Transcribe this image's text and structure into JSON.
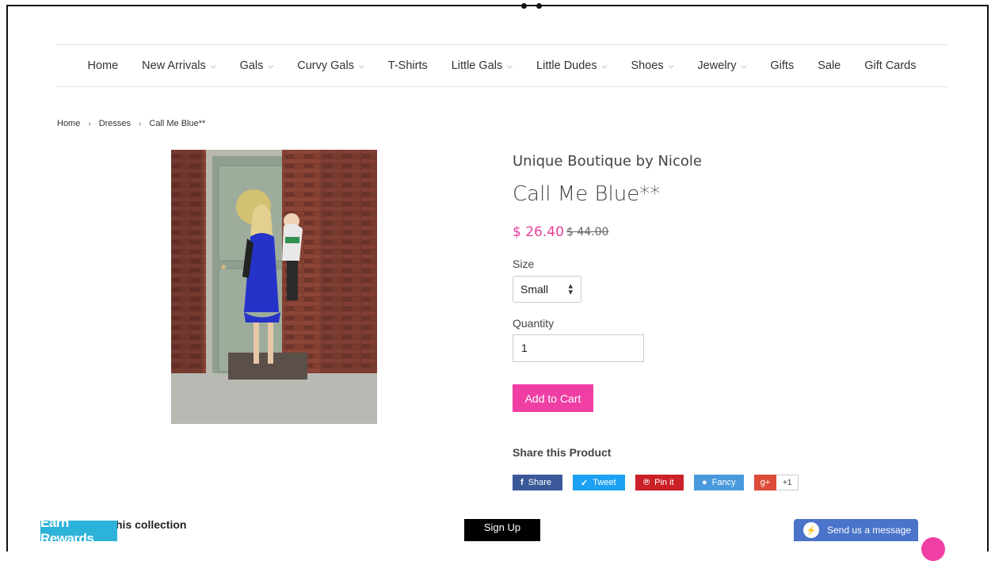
{
  "nav": {
    "items": [
      {
        "label": "Home",
        "dropdown": false
      },
      {
        "label": "New Arrivals",
        "dropdown": true
      },
      {
        "label": "Gals",
        "dropdown": true
      },
      {
        "label": "Curvy Gals",
        "dropdown": true
      },
      {
        "label": "T-Shirts",
        "dropdown": false
      },
      {
        "label": "Little Gals",
        "dropdown": true
      },
      {
        "label": "Little Dudes",
        "dropdown": true
      },
      {
        "label": "Shoes",
        "dropdown": true
      },
      {
        "label": "Jewelry",
        "dropdown": true
      },
      {
        "label": "Gifts",
        "dropdown": false
      },
      {
        "label": "Sale",
        "dropdown": false
      },
      {
        "label": "Gift Cards",
        "dropdown": false
      }
    ],
    "caret": "⌵"
  },
  "breadcrumb": {
    "home": "Home",
    "sep": "›",
    "category": "Dresses",
    "current": "Call Me Blue**"
  },
  "product": {
    "vendor": "Unique Boutique by Nicole",
    "title": "Call Me Blue**",
    "price": "$ 26.40",
    "compare_price": "$ 44.00",
    "size_label": "Size",
    "size_value": "Small",
    "quantity_label": "Quantity",
    "quantity_value": "1",
    "add_to_cart": "Add to Cart"
  },
  "share": {
    "title": "Share this Product",
    "facebook": "Share",
    "twitter": "Tweet",
    "pinterest": "Pin it",
    "fancy": "Fancy",
    "gplus_icon": "g+",
    "gplus_count": "+1"
  },
  "footer": {
    "collection_text": "his collection",
    "earn_rewards": "Earn Rewards",
    "signup": "Sign Up",
    "messenger": "Send us a message"
  },
  "colors": {
    "accent": "#ef3fa4",
    "price": "#e8409a",
    "facebook": "#3b5998",
    "twitter": "#1da1f2",
    "pinterest": "#cb2027",
    "fancy": "#4999dc",
    "gplus": "#dd4b39",
    "rewards": "#2db3d9",
    "messenger": "#4a74c9"
  }
}
